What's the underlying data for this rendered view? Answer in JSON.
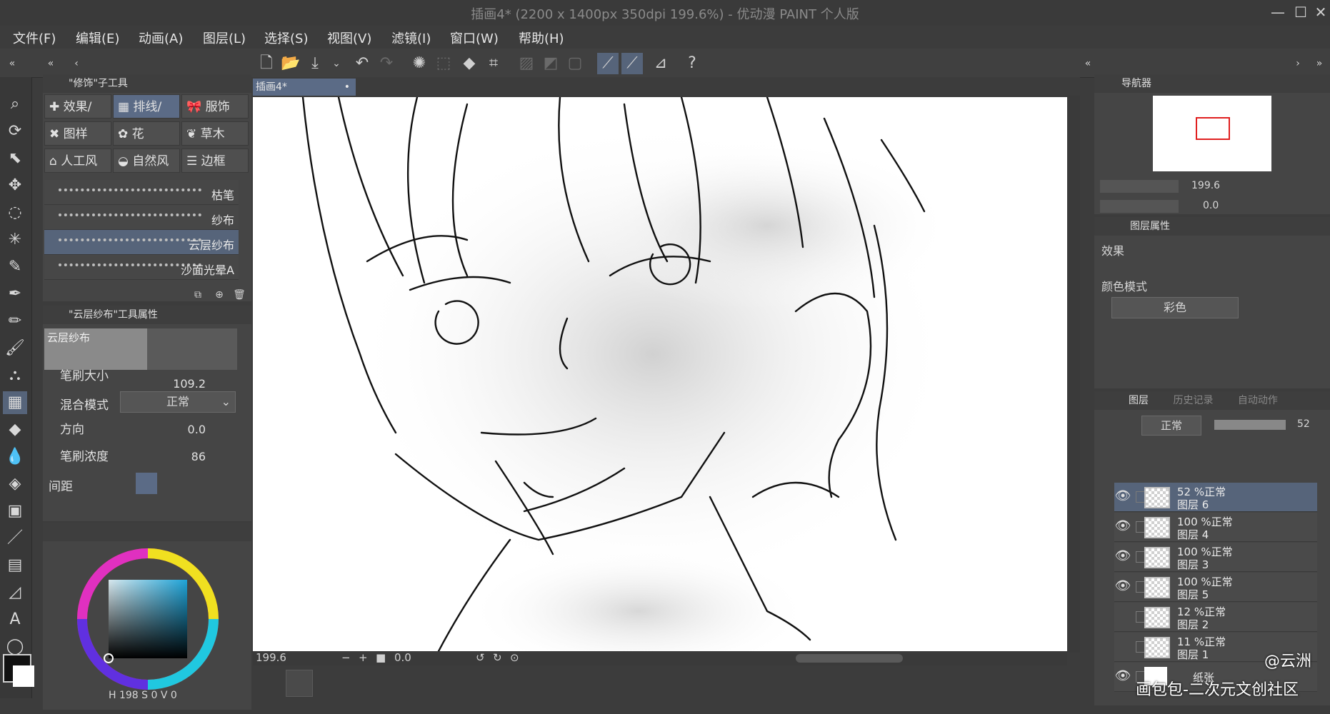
{
  "window": {
    "title": "插画4* (2200 x 1400px 350dpi 199.6%)  - 优动漫 PAINT 个人版",
    "controls": [
      "—",
      "☐",
      "✕"
    ]
  },
  "menu": [
    "文件(F)",
    "编辑(E)",
    "动画(A)",
    "图层(L)",
    "选择(S)",
    "视图(V)",
    "滤镜(I)",
    "窗口(W)",
    "帮助(H)"
  ],
  "subtool_panel": {
    "title": "\"修饰\"子工具",
    "tabs": [
      "效果/",
      "排线/",
      "服饰",
      "图样",
      "花",
      "草木",
      "人工风",
      "自然风",
      "边框"
    ],
    "active_tab": "排线/",
    "brushes": [
      "枯笔",
      "纱布",
      "云层纱布",
      "沙面光晕A"
    ],
    "active_brush": "云层纱布"
  },
  "tool_property": {
    "title": "\"云层纱布\"工具属性",
    "preview_label": "云层纱布",
    "brush_size_label": "笔刷大小",
    "brush_size": "109.2",
    "blend_label": "混合模式",
    "blend_value": "正常",
    "direction_label": "方向",
    "direction_value": "0.0",
    "density_label": "笔刷浓度",
    "density_value": "86",
    "spacing_label": "间距"
  },
  "color": {
    "h_label": "H",
    "h_value": "198",
    "s_label": "S",
    "s_value": "0",
    "v_label": "V",
    "v_value": "0",
    "main_color": "#111111",
    "sub_color": "#ffffff"
  },
  "document": {
    "tab": "插画4*",
    "zoom": "199.6",
    "rotation": "0.0"
  },
  "navigator": {
    "title": "导航器",
    "zoom": "199.6",
    "rotation": "0.0"
  },
  "layer_property": {
    "title": "图层属性",
    "effect_label": "效果",
    "color_mode_label": "颜色模式",
    "color_mode_value": "彩色"
  },
  "layers_panel": {
    "tabs": [
      "图层",
      "历史记录",
      "自动动作"
    ],
    "blend": "正常",
    "opacity": "52",
    "layers": [
      {
        "mode": "52 %正常",
        "name": "图层 6",
        "visible": true,
        "active": true
      },
      {
        "mode": "100 %正常",
        "name": "图层 4",
        "visible": true,
        "active": false
      },
      {
        "mode": "100 %正常",
        "name": "图层 3",
        "visible": true,
        "active": false
      },
      {
        "mode": "100 %正常",
        "name": "图层 5",
        "visible": true,
        "active": false
      },
      {
        "mode": "12 %正常",
        "name": "图层 2",
        "visible": false,
        "active": false
      },
      {
        "mode": "11 %正常",
        "name": "图层 1",
        "visible": false,
        "active": false
      },
      {
        "mode": "",
        "name": "纸张",
        "visible": true,
        "active": false
      }
    ]
  },
  "watermark": {
    "author": "@云洲",
    "site": "画包包-二次元文创社区"
  }
}
